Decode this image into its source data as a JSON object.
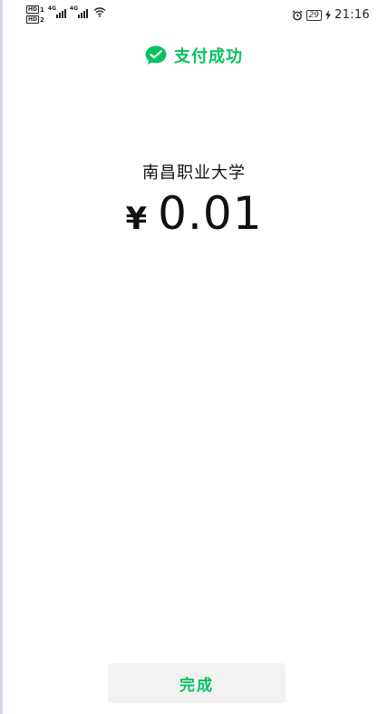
{
  "status_bar": {
    "sim1": "1",
    "sim2": "2",
    "hd_label": "HD",
    "net1": "4G",
    "net2": "4G",
    "battery": "29",
    "time": "21:16"
  },
  "header": {
    "title": "支付成功"
  },
  "payment": {
    "merchant": "南昌职业大学",
    "currency_symbol": "¥",
    "amount": "0.01"
  },
  "actions": {
    "done_label": "完成"
  },
  "colors": {
    "accent": "#07c160",
    "text": "#111111",
    "button_bg": "#f2f2f2"
  },
  "icons": {
    "success": "wechat-pay-check-icon",
    "alarm": "alarm-icon",
    "charging": "lightning-icon",
    "wifi": "wifi-icon"
  }
}
